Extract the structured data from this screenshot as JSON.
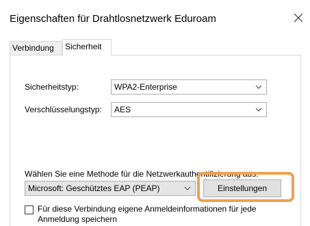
{
  "window": {
    "title": "Eigenschaften für Drahtlosnetzwerk Eduroam",
    "close_icon": "close-icon"
  },
  "tabs": [
    {
      "label": "Verbindung",
      "active": false
    },
    {
      "label": "Sicherheit",
      "active": true
    }
  ],
  "security": {
    "security_type_label": "Sicherheitstyp:",
    "security_type_value": "WPA2-Enterprise",
    "encryption_type_label": "Verschlüsselungstyp:",
    "encryption_type_value": "AES",
    "auth_method_label": "Wählen Sie eine Methode für die Netzwerkauthentifizierung aus:",
    "auth_method_value": "Microsoft: Geschütztes EAP (PEAP)",
    "settings_button_label": "Einstellungen",
    "remember_credentials_label": "Für diese Verbindung eigene Anmeldeinformationen für jede Anmeldung speichern",
    "remember_credentials_checked": false
  },
  "colors": {
    "highlight": "#f0a050",
    "border": "#adadad",
    "button_bg": "#e1e1e1"
  }
}
